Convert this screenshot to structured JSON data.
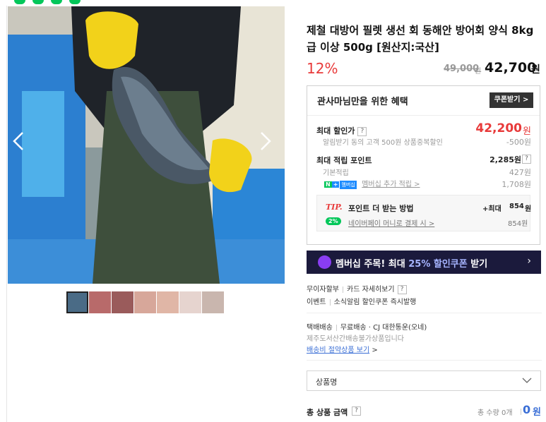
{
  "product": {
    "title": "제철 대방어 필렛 생선 회 동해안 방어회 양식 8kg급 이상 500g [원산지:국산]",
    "discount_rate": "12%",
    "original_price": "49,000",
    "original_unit": "원",
    "sale_price": "42,700",
    "sale_unit": "원"
  },
  "benefit": {
    "heading": "관사마님만을 위한 혜택",
    "coupon_button": "쿠폰받기 >",
    "max_discount_label": "최대 할인가",
    "max_discount_value": "42,200",
    "max_discount_unit": "원",
    "coupon_note": "알림받기 동의 고객 500원 상품중복할인",
    "coupon_note_value": "-500원",
    "max_points_label": "최대 적립 포인트",
    "max_points_value": "2,285원",
    "basic_points_label": "기본적립",
    "basic_points_value": "427원",
    "membership_badge_n": "N",
    "membership_badge_plus": "+",
    "membership_badge_tag": "멤버십",
    "membership_points_label": "멤버십 추가 적립 >",
    "membership_points_value": "1,708원",
    "tip_label": "TIP.",
    "tip_text": "포인트 더 받는 방법",
    "tip_max": "+최대",
    "tip_max_value": "854",
    "tip_max_unit": "원",
    "pay_badge": "2%",
    "pay_text": "네이버페이 머니로 결제 시 >",
    "pay_value": "854원"
  },
  "banner": {
    "text_prefix": "멤버십 주목! 최대 ",
    "text_highlight": "25% 할인쿠폰",
    "text_suffix": " 받기",
    "arrow": "›"
  },
  "payment": {
    "installment": "무이자할부",
    "card_detail": "카드 자세히보기",
    "event_label": "이벤트",
    "event_text": "소식알림 할인쿠폰 즉시발행"
  },
  "delivery": {
    "type": "택배배송",
    "info": "무료배송 · CJ 대한통운(오네)",
    "notice": "제주도서산간배송불가상품입니다",
    "saving_link": "배송비 절약상품 보기",
    "saving_arrow": ">"
  },
  "option_select": {
    "placeholder": "상품명"
  },
  "total": {
    "label": "총 상품 금액",
    "qty_text": "총 수량 0개",
    "amount": "0",
    "unit": "원"
  },
  "icons": {
    "question": "?",
    "prev": "chevron-left-icon",
    "next": "chevron-right-icon"
  },
  "colors": {
    "discount_red": "#e83a3a",
    "naver_green": "#03c75a",
    "banner_bg": "#1b1a3c",
    "link_blue": "#3b6fd6"
  }
}
